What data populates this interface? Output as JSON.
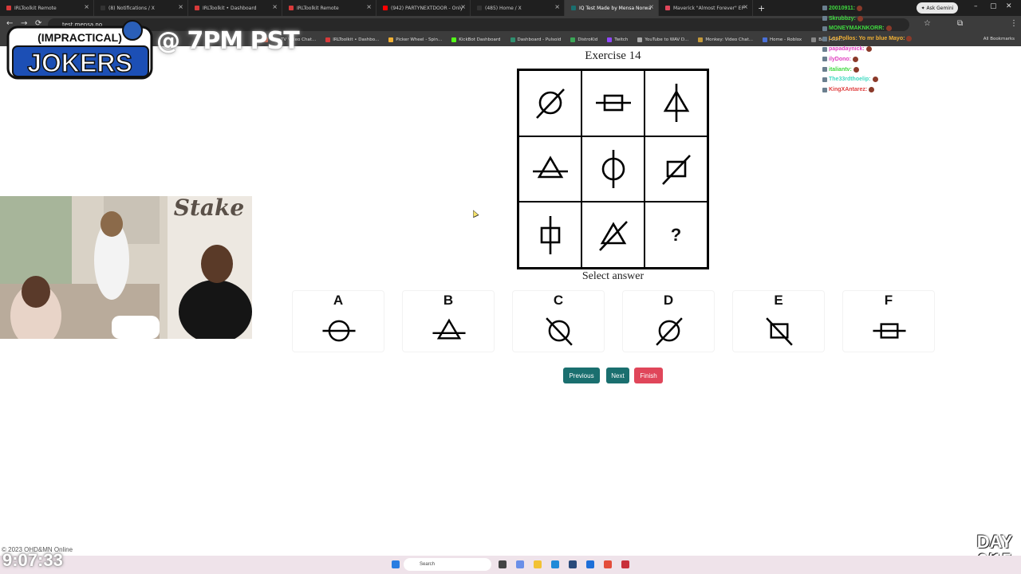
{
  "browser": {
    "tabs": [
      {
        "title": "IRLToolkit Remote",
        "favicon_color": "#d83a3a",
        "active": false
      },
      {
        "title": "(8) Notifications / X",
        "favicon_color": "#333333",
        "active": false
      },
      {
        "title": "IRLToolkit • Dashboard",
        "favicon_color": "#d83a3a",
        "active": false
      },
      {
        "title": "IRLToolkit Remote",
        "favicon_color": "#d83a3a",
        "active": false
      },
      {
        "title": "(942) PARTYNEXTDOOR - Only",
        "favicon_color": "#ff0000",
        "active": false
      },
      {
        "title": "(485) Home / X",
        "favicon_color": "#333333",
        "active": false
      },
      {
        "title": "IQ Test Made by Mensa Norwa",
        "favicon_color": "#1a6f6f",
        "active": true
      },
      {
        "title": "Maverick \"Almost Forever\" EP",
        "favicon_color": "#e0465a",
        "active": false
      }
    ],
    "tab_close": "×",
    "new_tab": "+",
    "ask_gemini": "✦ Ask Gemini",
    "url": "test.mensa.no",
    "bookmarks": [
      {
        "label": "OmeTV Video Chat...",
        "color": "#e2644a"
      },
      {
        "label": "IRLToolkit • Dashbo...",
        "color": "#d83a3a"
      },
      {
        "label": "Picker Wheel - Spin...",
        "color": "#f2b134"
      },
      {
        "label": "KickBot Dashboard",
        "color": "#53fc18"
      },
      {
        "label": "Dashboard - Pulsoid",
        "color": "#2f8f6f"
      },
      {
        "label": "DistroKid",
        "color": "#3aa657"
      },
      {
        "label": "Twitch",
        "color": "#9146ff"
      },
      {
        "label": "YouTube to WAV D...",
        "color": "#aaaaaa"
      },
      {
        "label": "Monkey: Video Chat...",
        "color": "#c49a3a"
      },
      {
        "label": "Home - Roblox",
        "color": "#4a70d8"
      },
      {
        "label": "Bau | Curr...",
        "color": "#888888"
      }
    ],
    "all_bookmarks": "All Bookmarks"
  },
  "page": {
    "exercise_title": "Exercise 14",
    "grid_cells": [
      {
        "shape": "circle-slash"
      },
      {
        "shape": "square-hbar"
      },
      {
        "shape": "triangle-vbar"
      },
      {
        "shape": "triangle-hbar"
      },
      {
        "shape": "circle-vbar"
      },
      {
        "shape": "square-slash"
      },
      {
        "shape": "square-vbar"
      },
      {
        "shape": "triangle-slash"
      },
      {
        "shape": "question",
        "text": "?"
      }
    ],
    "select_label": "Select answer",
    "answers": [
      {
        "letter": "A",
        "shape": "circle-hbar"
      },
      {
        "letter": "B",
        "shape": "triangle-hbar"
      },
      {
        "letter": "C",
        "shape": "circle-backslash"
      },
      {
        "letter": "D",
        "shape": "circle-slash"
      },
      {
        "letter": "E",
        "shape": "square-backslash"
      },
      {
        "letter": "F",
        "shape": "square-hbar"
      }
    ],
    "buttons": {
      "previous": "Previous",
      "next": "Next",
      "finish": "Finish"
    },
    "colors": {
      "primary_button": "#1a6f6f",
      "finish_button": "#e0465a"
    }
  },
  "overlay": {
    "logo_top": "(IMPRACTICAL)",
    "logo_main": "JOKERS",
    "stream_time": "@ 7PM PST",
    "webcam_sign": "Stake",
    "chat": [
      {
        "user": "20010911:",
        "color": "#3fd93f"
      },
      {
        "user": "Skrubbzy:",
        "color": "#3fd93f"
      },
      {
        "user": "MONEYMAKNKORR:",
        "color": "#3fd93f"
      },
      {
        "user": "LosPollos: Yo mr blue Mayo:",
        "color": "#f2b134"
      },
      {
        "user": "papadaynick:",
        "color": "#e040c0"
      },
      {
        "user": "ilyDono:",
        "color": "#e040c0"
      },
      {
        "user": "italiantv:",
        "color": "#3fd93f"
      },
      {
        "user": "The33rdthoelip:",
        "color": "#3fd9c0"
      },
      {
        "user": "KingXAntarez:",
        "color": "#e04040"
      }
    ],
    "copyright": "© 2023 OHD&MN Online",
    "uptime": "9:07:33",
    "day_label": "DAY",
    "day_count": "6/15",
    "taskbar_search": "Search"
  }
}
